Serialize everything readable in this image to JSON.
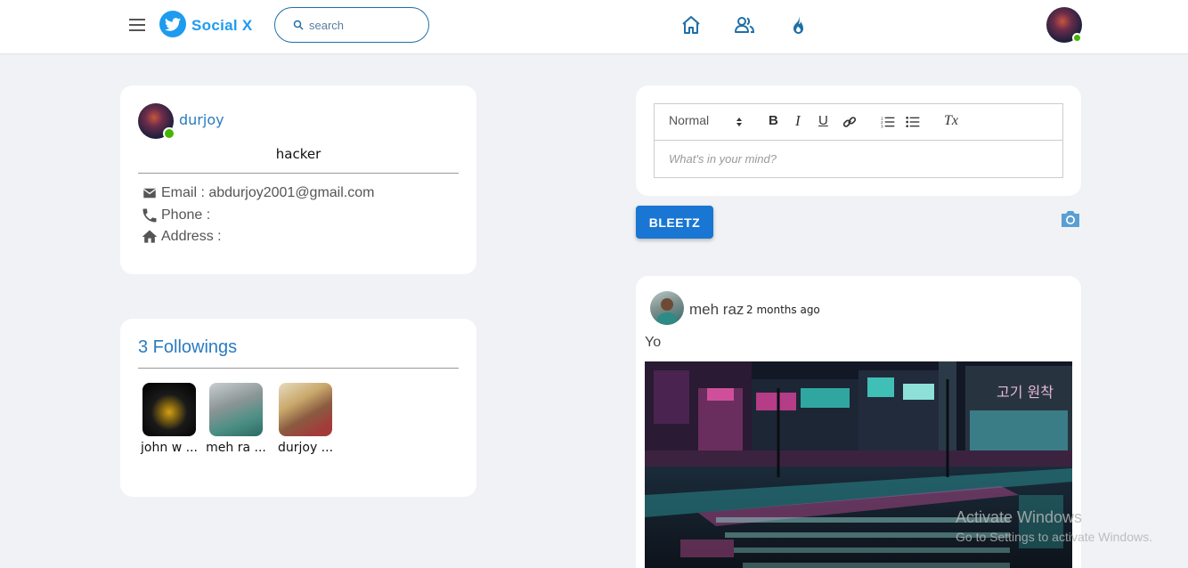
{
  "header": {
    "brand": "Social X",
    "search_placeholder": "search"
  },
  "profile": {
    "name": "durjoy",
    "bio": "hacker",
    "email_label": "Email : abdurjoy2001@gmail.com",
    "phone_label": "Phone :",
    "address_label": "Address :",
    "online": true
  },
  "followings": {
    "title": "3 Followings",
    "items": [
      {
        "name": "john w ..."
      },
      {
        "name": "meh ra ..."
      },
      {
        "name": "durjoy ..."
      }
    ]
  },
  "editor": {
    "format_label": "Normal",
    "placeholder": "What's in your mind?",
    "bold": "B",
    "italic": "I",
    "underline": "U",
    "clear": "Tx"
  },
  "actions": {
    "submit_label": "BLEETZ"
  },
  "post": {
    "author": "meh raz",
    "time": "2 months ago",
    "text": "Yo",
    "image_sign_1": "고기 원착"
  },
  "watermark": {
    "line1": "Activate Windows",
    "line2": "Go to Settings to activate Windows."
  },
  "colors": {
    "brand": "#1d9bf0",
    "accent": "#1976d2",
    "nav_icon": "#1f6fa8",
    "online": "#44b700"
  }
}
